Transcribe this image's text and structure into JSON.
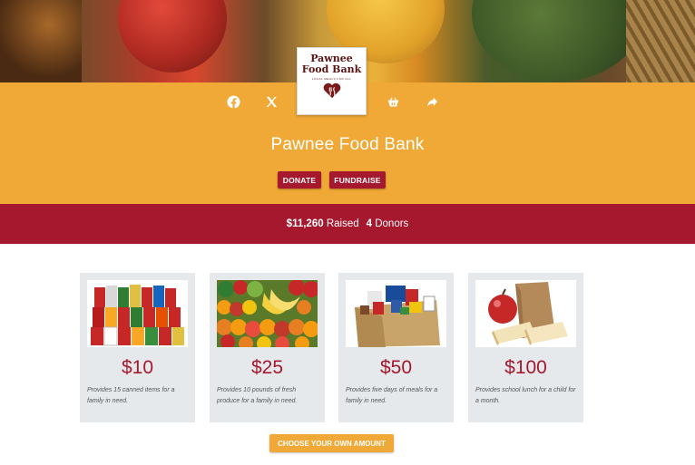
{
  "org": {
    "name": "Pawnee Food Bank",
    "logo_line1": "Pawnee",
    "logo_line2": "Food Bank",
    "logo_tagline": "LOCAL MEALS FOR ALL"
  },
  "share_icons": [
    "facebook-icon",
    "x-icon",
    "basket-icon",
    "share-icon"
  ],
  "actions": {
    "donate_label": "DONATE",
    "fundraise_label": "FUNDRAISE"
  },
  "stats": {
    "raised_amount": "$11,260",
    "raised_label": "Raised",
    "donor_count": "4",
    "donor_label": "Donors"
  },
  "gifts": [
    {
      "amount": "$10",
      "description": "Provides 15 canned items for a family in need."
    },
    {
      "amount": "$25",
      "description": "Provides 10 pounds of fresh produce for a family in need."
    },
    {
      "amount": "$50",
      "description": "Provides five days of meals for a family in need."
    },
    {
      "amount": "$100",
      "description": "Provides school lunch for a child for a month."
    }
  ],
  "choose_amount_label": "CHOOSE YOUR OWN AMOUNT",
  "colors": {
    "band_orange": "#f0a936",
    "brand_red": "#a5182e",
    "card_gray": "#e6e9ec"
  }
}
